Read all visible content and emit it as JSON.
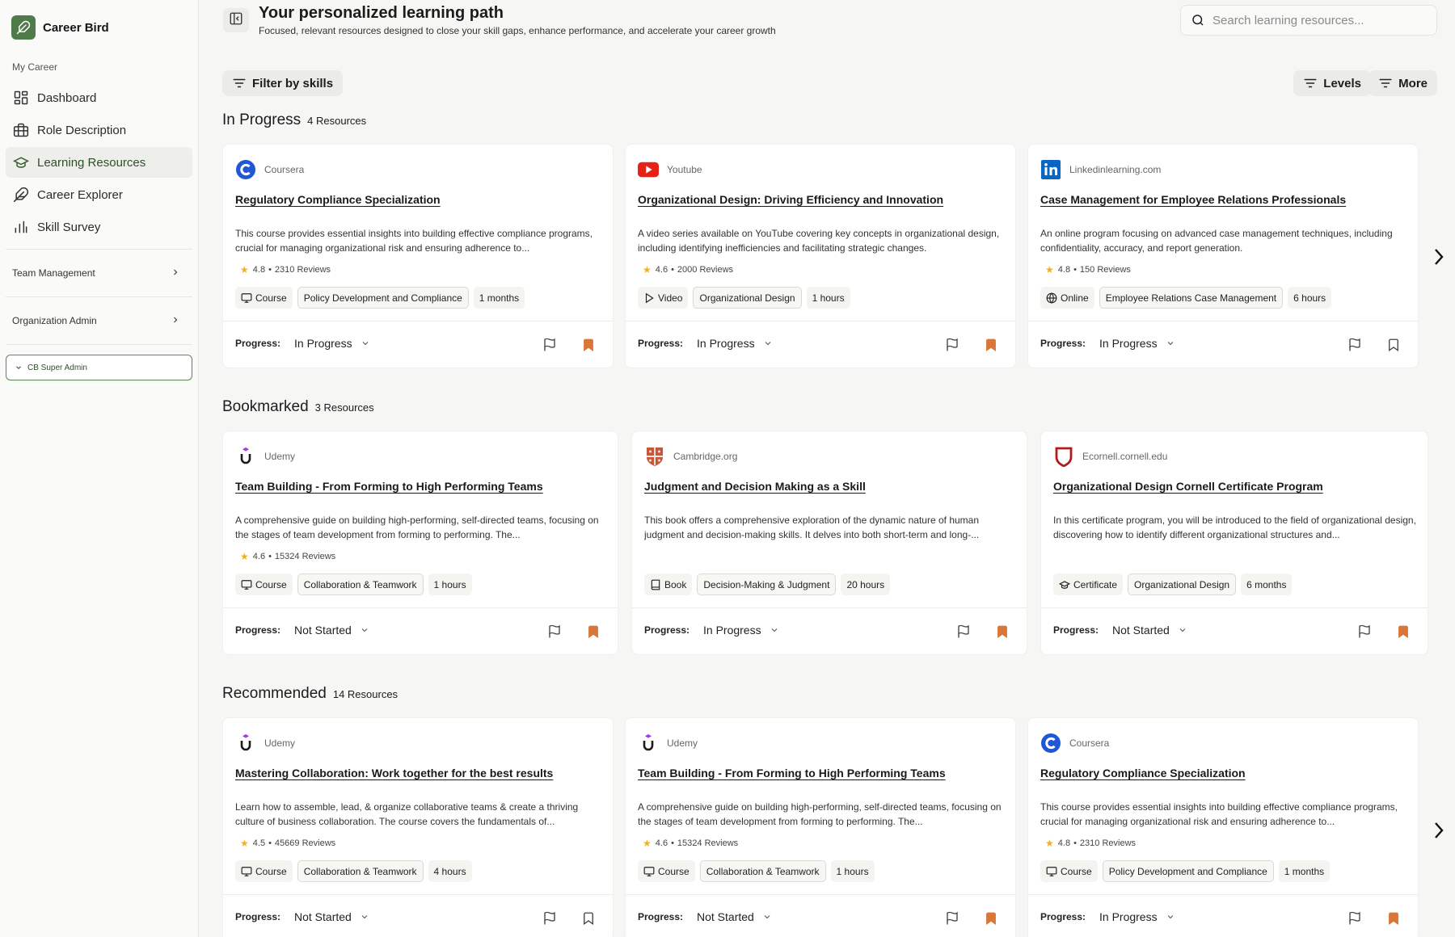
{
  "sidebar": {
    "brand": "Career Bird",
    "section": "My Career",
    "items": [
      {
        "label": "Dashboard",
        "icon": "dashboard-icon"
      },
      {
        "label": "Role Description",
        "icon": "briefcase-icon"
      },
      {
        "label": "Learning Resources",
        "icon": "graduation-cap-icon",
        "active": true
      },
      {
        "label": "Career Explorer",
        "icon": "feather-icon"
      },
      {
        "label": "Skill Survey",
        "icon": "bar-chart-icon"
      }
    ],
    "groups": [
      {
        "label": "Team Management"
      },
      {
        "label": "Organization Admin"
      }
    ],
    "admin": "CB Super Admin"
  },
  "header": {
    "title": "Your personalized learning path",
    "subtitle": "Focused, relevant resources designed to close your skill gaps, enhance performance, and accelerate your career growth",
    "search_placeholder": "Search learning resources..."
  },
  "filters": {
    "skills": "Filter by skills",
    "levels": "Levels",
    "more": "More"
  },
  "labels": {
    "progress": "Progress:"
  },
  "colors": {
    "accent": "#4f7a4a",
    "bookmark": "#d9773a",
    "star": "#f2b01e"
  },
  "sections": [
    {
      "title": "In Progress",
      "count": "4 Resources",
      "cards": [
        {
          "source": "Coursera",
          "logo": "coursera",
          "title": "Regulatory Compliance Specialization",
          "desc": "This course provides essential insights into building effective compliance programs, crucial for managing organizational risk and ensuring adherence to...",
          "rating": "4.8",
          "reviews": "2310 Reviews",
          "type": "Course",
          "type_icon": "monitor-icon",
          "skill": "Policy Development and Compliance",
          "duration": "1 months",
          "progress": "In Progress",
          "bookmarked": true
        },
        {
          "source": "Youtube",
          "logo": "youtube",
          "title": "Organizational Design: Driving Efficiency and Innovation",
          "desc": "A video series available on YouTube covering key concepts in organizational design, including identifying inefficiencies and facilitating strategic changes.",
          "rating": "4.6",
          "reviews": "2000 Reviews",
          "type": "Video",
          "type_icon": "play-icon",
          "skill": "Organizational Design",
          "duration": "1 hours",
          "progress": "In Progress",
          "bookmarked": true
        },
        {
          "source": "Linkedinlearning.com",
          "logo": "linkedin",
          "title": "Case Management for Employee Relations Professionals",
          "desc": "An online program focusing on advanced case management techniques, including confidentiality, accuracy, and report generation.",
          "rating": "4.8",
          "reviews": "150 Reviews",
          "type": "Online",
          "type_icon": "globe-icon",
          "skill": "Employee Relations Case Management",
          "duration": "6 hours",
          "progress": "In Progress",
          "bookmarked": false
        }
      ]
    },
    {
      "title": "Bookmarked",
      "count": "3 Resources",
      "cards": [
        {
          "source": "Udemy",
          "logo": "udemy",
          "title": "Team Building - From Forming to High Performing Teams",
          "desc": "A comprehensive guide on building high-performing, self-directed teams, focusing on the stages of team development from forming to performing. The...",
          "rating": "4.6",
          "reviews": "15324 Reviews",
          "type": "Course",
          "type_icon": "monitor-icon",
          "skill": "Collaboration & Teamwork",
          "duration": "1 hours",
          "progress": "Not Started",
          "bookmarked": true
        },
        {
          "source": "Cambridge.org",
          "logo": "cambridge",
          "title": "Judgment and Decision Making as a Skill",
          "desc": "This book offers a comprehensive exploration of the dynamic nature of human judgment and decision-making skills. It delves into both short-term and long-...",
          "rating": "",
          "reviews": "",
          "type": "Book",
          "type_icon": "book-icon",
          "skill": "Decision-Making & Judgment",
          "duration": "20 hours",
          "progress": "In Progress",
          "bookmarked": true
        },
        {
          "source": "Ecornell.cornell.edu",
          "logo": "cornell",
          "title": "Organizational Design Cornell Certificate Program",
          "desc": "In this certificate program, you will be introduced to the field of organizational design, discovering how to identify different organizational structures and...",
          "rating": "",
          "reviews": "",
          "type": "Certificate",
          "type_icon": "cap-icon",
          "skill": "Organizational Design",
          "duration": "6 months",
          "progress": "Not Started",
          "bookmarked": true
        }
      ]
    },
    {
      "title": "Recommended",
      "count": "14 Resources",
      "cards": [
        {
          "source": "Udemy",
          "logo": "udemy",
          "title": "Mastering Collaboration: Work together for the best results",
          "desc": "Learn how to assemble, lead, & organize collaborative teams & create a thriving culture of business collaboration. The course covers the fundamentals of...",
          "rating": "4.5",
          "reviews": "45669 Reviews",
          "type": "Course",
          "type_icon": "monitor-icon",
          "skill": "Collaboration & Teamwork",
          "duration": "4 hours",
          "progress": "Not Started",
          "bookmarked": false
        },
        {
          "source": "Udemy",
          "logo": "udemy",
          "title": "Team Building - From Forming to High Performing Teams",
          "desc": "A comprehensive guide on building high-performing, self-directed teams, focusing on the stages of team development from forming to performing. The...",
          "rating": "4.6",
          "reviews": "15324 Reviews",
          "type": "Course",
          "type_icon": "monitor-icon",
          "skill": "Collaboration & Teamwork",
          "duration": "1 hours",
          "progress": "Not Started",
          "bookmarked": true
        },
        {
          "source": "Coursera",
          "logo": "coursera",
          "title": "Regulatory Compliance Specialization",
          "desc": "This course provides essential insights into building effective compliance programs, crucial for managing organizational risk and ensuring adherence to...",
          "rating": "4.8",
          "reviews": "2310 Reviews",
          "type": "Course",
          "type_icon": "monitor-icon",
          "skill": "Policy Development and Compliance",
          "duration": "1 months",
          "progress": "In Progress",
          "bookmarked": true
        }
      ]
    }
  ]
}
